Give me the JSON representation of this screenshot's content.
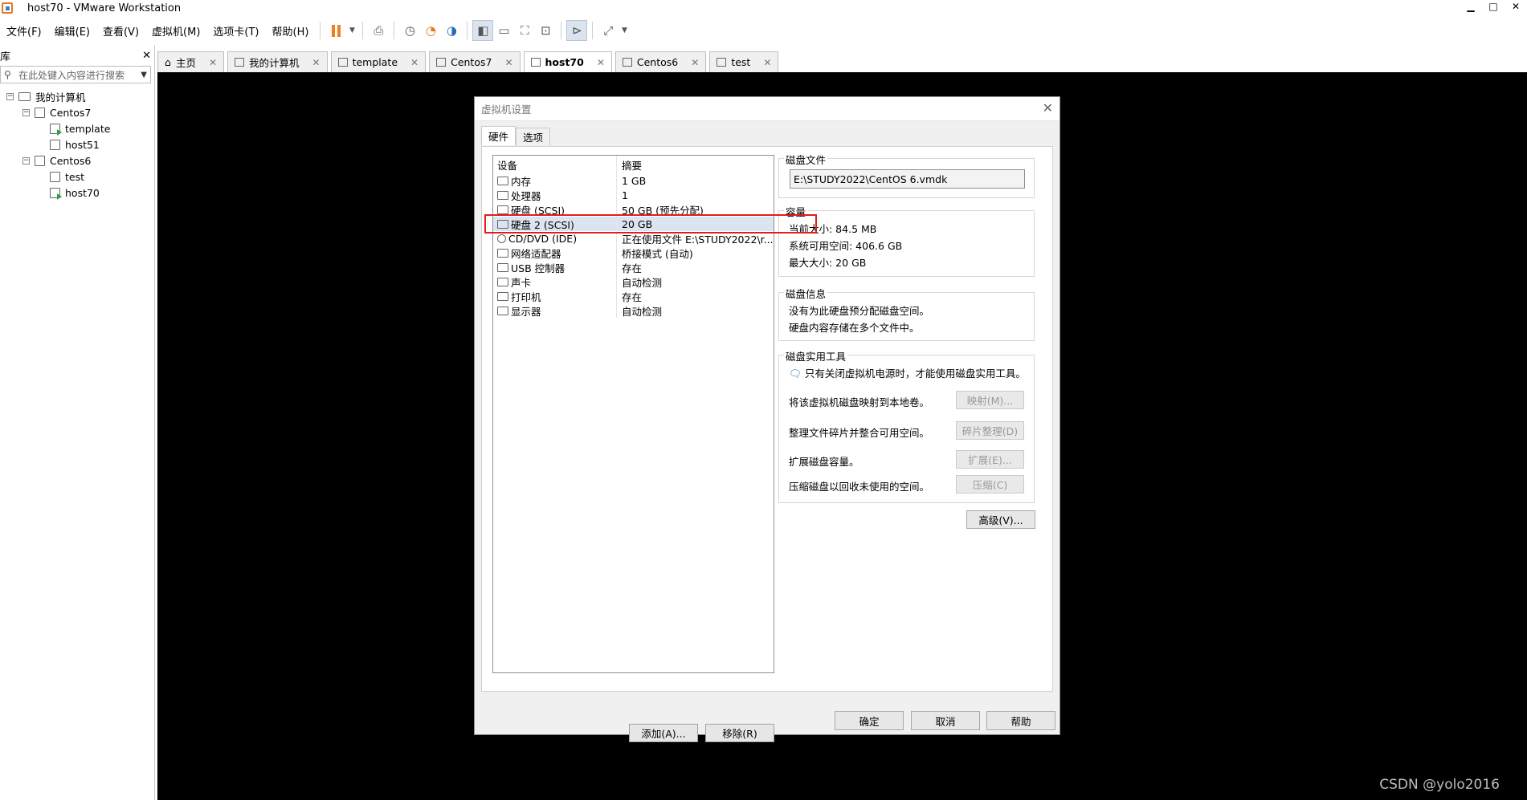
{
  "window": {
    "title": "host70 - VMware Workstation",
    "minimize": "▁",
    "maximize": "□",
    "close": "✕"
  },
  "menu": [
    "文件(F)",
    "编辑(E)",
    "查看(V)",
    "虚拟机(M)",
    "选项卡(T)",
    "帮助(H)"
  ],
  "sidebar": {
    "title": "库",
    "close": "✕",
    "search_placeholder": "在此处键入内容进行搜索",
    "tree": [
      {
        "label": "我的计算机",
        "level": 0
      },
      {
        "label": "Centos7",
        "level": 1
      },
      {
        "label": "template",
        "level": 2
      },
      {
        "label": "host51",
        "level": 2
      },
      {
        "label": "Centos6",
        "level": 1
      },
      {
        "label": "test",
        "level": 2
      },
      {
        "label": "host70",
        "level": 2
      }
    ]
  },
  "tabs": [
    {
      "label": "主页"
    },
    {
      "label": "我的计算机"
    },
    {
      "label": "template"
    },
    {
      "label": "Centos7"
    },
    {
      "label": "host70"
    },
    {
      "label": "Centos6"
    },
    {
      "label": "test"
    }
  ],
  "dialog": {
    "title": "虚拟机设置",
    "tabs": [
      "硬件",
      "选项"
    ],
    "list_headers": {
      "device": "设备",
      "summary": "摘要"
    },
    "devices": [
      {
        "name": "内存",
        "summary": "1 GB"
      },
      {
        "name": "处理器",
        "summary": "1"
      },
      {
        "name": "硬盘 (SCSI)",
        "summary": "50 GB (预先分配)"
      },
      {
        "name": "硬盘 2 (SCSI)",
        "summary": "20 GB"
      },
      {
        "name": "CD/DVD (IDE)",
        "summary": "正在使用文件 E:\\STUDY2022\\r..."
      },
      {
        "name": "网络适配器",
        "summary": "桥接模式 (自动)"
      },
      {
        "name": "USB 控制器",
        "summary": "存在"
      },
      {
        "name": "声卡",
        "summary": "自动检测"
      },
      {
        "name": "打印机",
        "summary": "存在"
      },
      {
        "name": "显示器",
        "summary": "自动检测"
      }
    ],
    "add_button": "添加(A)...",
    "remove_button": "移除(R)",
    "disk_file": {
      "title": "磁盘文件",
      "value": "E:\\STUDY2022\\CentOS 6.vmdk"
    },
    "capacity": {
      "title": "容量",
      "current": "当前大小: 84.5 MB",
      "available": "系统可用空间: 406.6 GB",
      "max": "最大大小: 20 GB"
    },
    "disk_info": {
      "title": "磁盘信息",
      "line1": "没有为此硬盘预分配磁盘空间。",
      "line2": "硬盘内容存储在多个文件中。"
    },
    "utilities": {
      "title": "磁盘实用工具",
      "note": "只有关闭虚拟机电源时，才能使用磁盘实用工具。",
      "map_text": "将该虚拟机磁盘映射到本地卷。",
      "map_btn": "映射(M)...",
      "defrag_text": "整理文件碎片并整合可用空间。",
      "defrag_btn": "碎片整理(D)",
      "expand_text": "扩展磁盘容量。",
      "expand_btn": "扩展(E)...",
      "compact_text": "压缩磁盘以回收未使用的空间。",
      "compact_btn": "压缩(C)"
    },
    "advanced_btn": "高级(V)...",
    "ok": "确定",
    "cancel": "取消",
    "help": "帮助"
  },
  "watermark": "CSDN @yolo2016"
}
